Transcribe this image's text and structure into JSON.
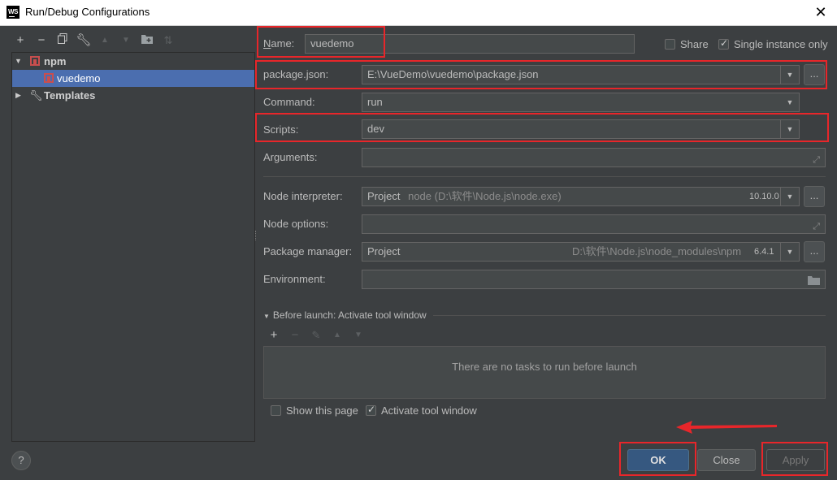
{
  "window": {
    "title": "Run/Debug Configurations",
    "app_icon_text": "WS"
  },
  "tree": {
    "npm_label": "npm",
    "config_label": "vuedemo",
    "templates_label": "Templates"
  },
  "form": {
    "name_label": "Name:",
    "name_value": "vuedemo",
    "share_label": "Share",
    "share_checked": false,
    "single_instance_label": "Single instance only",
    "single_instance_checked": true,
    "package_json_label": "package.json:",
    "package_json_value": "E:\\VueDemo\\vuedemo\\package.json",
    "command_label": "Command:",
    "command_value": "run",
    "scripts_label": "Scripts:",
    "scripts_value": "dev",
    "arguments_label": "Arguments:",
    "node_interpreter_label": "Node interpreter:",
    "node_interpreter_project": "Project",
    "node_interpreter_path": "node (D:\\软件\\Node.js\\node.exe)",
    "node_version": "10.10.0",
    "node_options_label": "Node options:",
    "package_manager_label": "Package manager:",
    "package_manager_project": "Project",
    "package_manager_path": "D:\\软件\\Node.js\\node_modules\\npm",
    "package_manager_version": "6.4.1",
    "environment_label": "Environment:",
    "before_launch_label": "Before launch: Activate tool window",
    "no_tasks_text": "There are no tasks to run before launch",
    "show_page_label": "Show this page",
    "show_page_checked": false,
    "activate_tool_label": "Activate tool window",
    "activate_tool_checked": true
  },
  "buttons": {
    "browse": "...",
    "ok": "OK",
    "close": "Close",
    "apply": "Apply",
    "help": "?"
  },
  "colors": {
    "highlight": "#e8262a",
    "selection": "#4b6eaf",
    "primary_button": "#365880"
  }
}
